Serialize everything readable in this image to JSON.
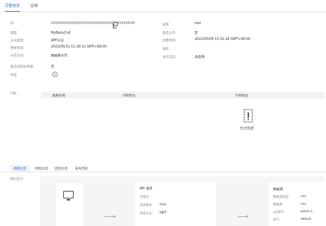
{
  "tabs": [
    {
      "label": "完整信息",
      "active": true
    },
    {
      "label": "运维",
      "active": false
    }
  ],
  "info": {
    "left": [
      {
        "label": "ID",
        "value": "0000000000000000000000000000000000000008"
      },
      {
        "label": "类型",
        "value": "MyBatis方式"
      },
      {
        "label": "认证类型",
        "value": "APP认证"
      },
      {
        "label": "更新时间",
        "value": "2022/05/31 11:18:11 GMT+08:00"
      },
      {
        "label": "分页方式",
        "value": "数据库分页"
      },
      {
        "label": "是否返回总条数",
        "value": "否"
      },
      {
        "label": "标签",
        "value": ""
      }
    ],
    "right": [
      {
        "label": "名称",
        "value": "test"
      },
      {
        "label": "是否公开",
        "value": "否"
      },
      {
        "label": "创建时间",
        "value": "2022/05/06 15:31:28 GMT+08:00"
      },
      {
        "label": "描述",
        "value": ""
      },
      {
        "label": "访问日志",
        "value": "未启用"
      }
    ]
  },
  "url": {
    "label": "URL",
    "columns": [
      "集群名称",
      "内网地址",
      "外网地址"
    ],
    "empty_text": "暂无数据"
  },
  "subtabs": [
    {
      "label": "调用信息",
      "active": true
    },
    {
      "label": "授权信息",
      "active": false
    },
    {
      "label": "流控信息",
      "active": false
    },
    {
      "label": "发布历史",
      "active": false
    }
  ],
  "flow": {
    "section_label": "接口定义",
    "api_card": {
      "title": "API 请求",
      "rows": [
        {
          "label": "子域名：",
          "value": ""
        },
        {
          "label": "请求路径：",
          "value": "/test"
        },
        {
          "label": "请求方法：",
          "value": "GET"
        }
      ]
    },
    "ds_card": {
      "title": "数据源",
      "rows": [
        {
          "label": "数据源类型：",
          "value": "xxx"
        },
        {
          "label": "数据源：",
          "value": "xxx"
        },
        {
          "label": "sql语句：",
          "value": "select 1..."
        },
        {
          "label": "执行：",
          "value": "default"
        }
      ]
    }
  }
}
